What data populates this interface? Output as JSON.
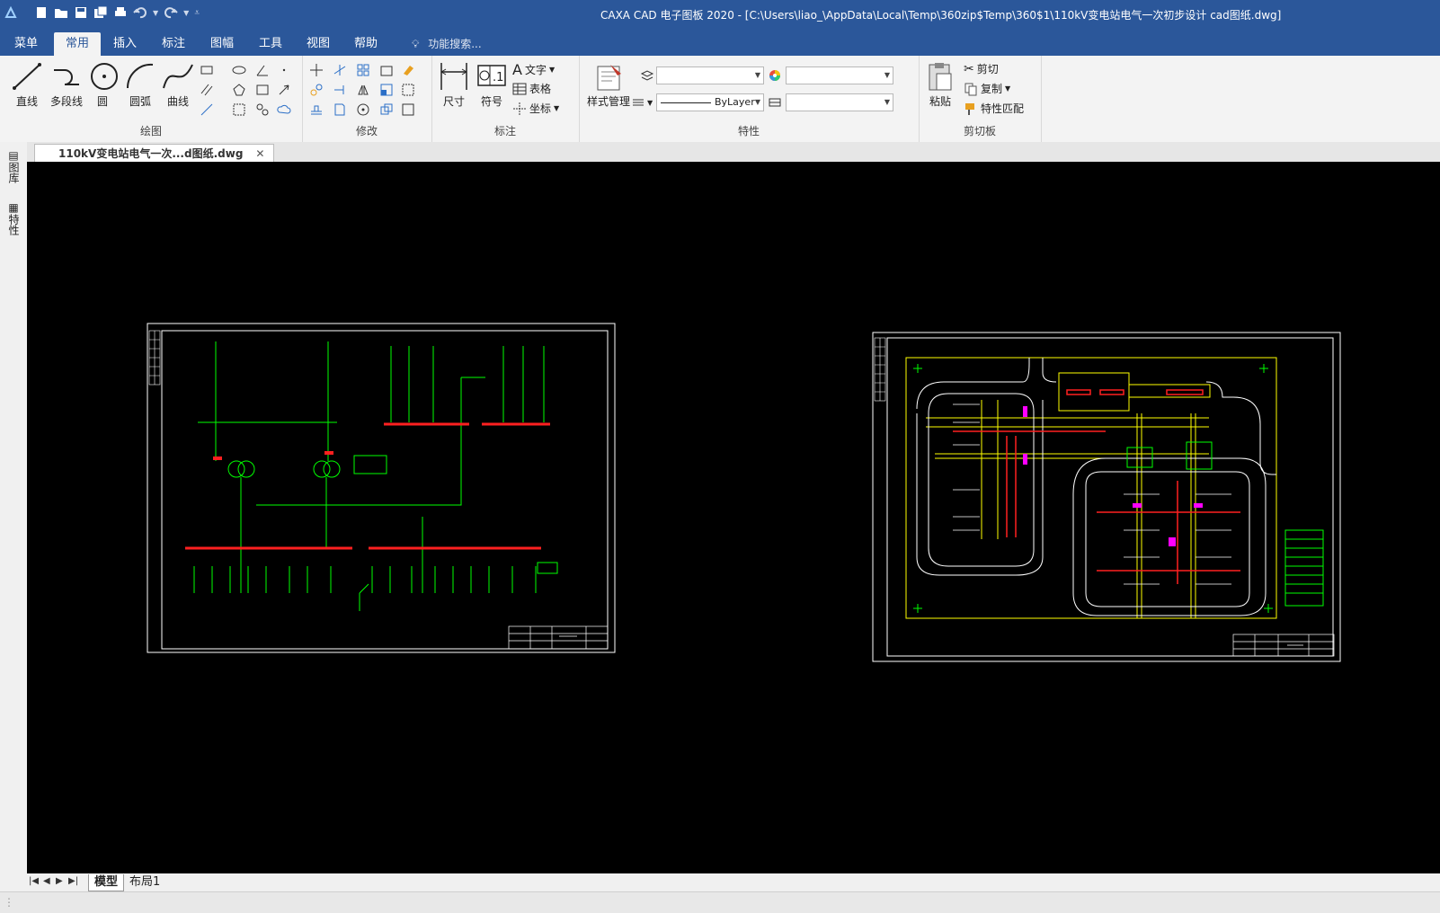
{
  "window": {
    "title": "CAXA CAD 电子图板 2020 - [C:\\Users\\liao_\\AppData\\Local\\Temp\\360zip$Temp\\360$1\\110kV变电站电气一次初步设计 cad图纸.dwg]"
  },
  "menu": {
    "items": [
      "菜单",
      "常用",
      "插入",
      "标注",
      "图幅",
      "工具",
      "视图",
      "帮助"
    ],
    "active": "常用",
    "search_placeholder": "功能搜索..."
  },
  "ribbon": {
    "draw": {
      "label": "绘图",
      "buttons": [
        "直线",
        "多段线",
        "圆",
        "圆弧",
        "曲线"
      ]
    },
    "modify": {
      "label": "修改"
    },
    "annotate": {
      "label": "标注",
      "buttons": [
        "尺寸",
        "符号"
      ],
      "small": [
        "文字",
        "表格",
        "坐标"
      ]
    },
    "properties": {
      "label": "特性",
      "style_button": "样式管理",
      "linetype_value": "ByLayer"
    },
    "clipboard": {
      "label": "剪切板",
      "paste": "粘贴",
      "small": [
        "剪切",
        "复制",
        "特性匹配"
      ]
    }
  },
  "side_panel": {
    "tabs": [
      "图库",
      "特性"
    ]
  },
  "document": {
    "tab_label": "110kV变电站电气一次...d图纸.dwg"
  },
  "layout_tabs": [
    "模型",
    "布局1"
  ],
  "colors": {
    "accent": "#2b579a",
    "canvas": "#000000",
    "cad_green": "#00ff00",
    "cad_red": "#ff2020",
    "cad_yellow": "#ffff00",
    "cad_magenta": "#ff00ff"
  }
}
